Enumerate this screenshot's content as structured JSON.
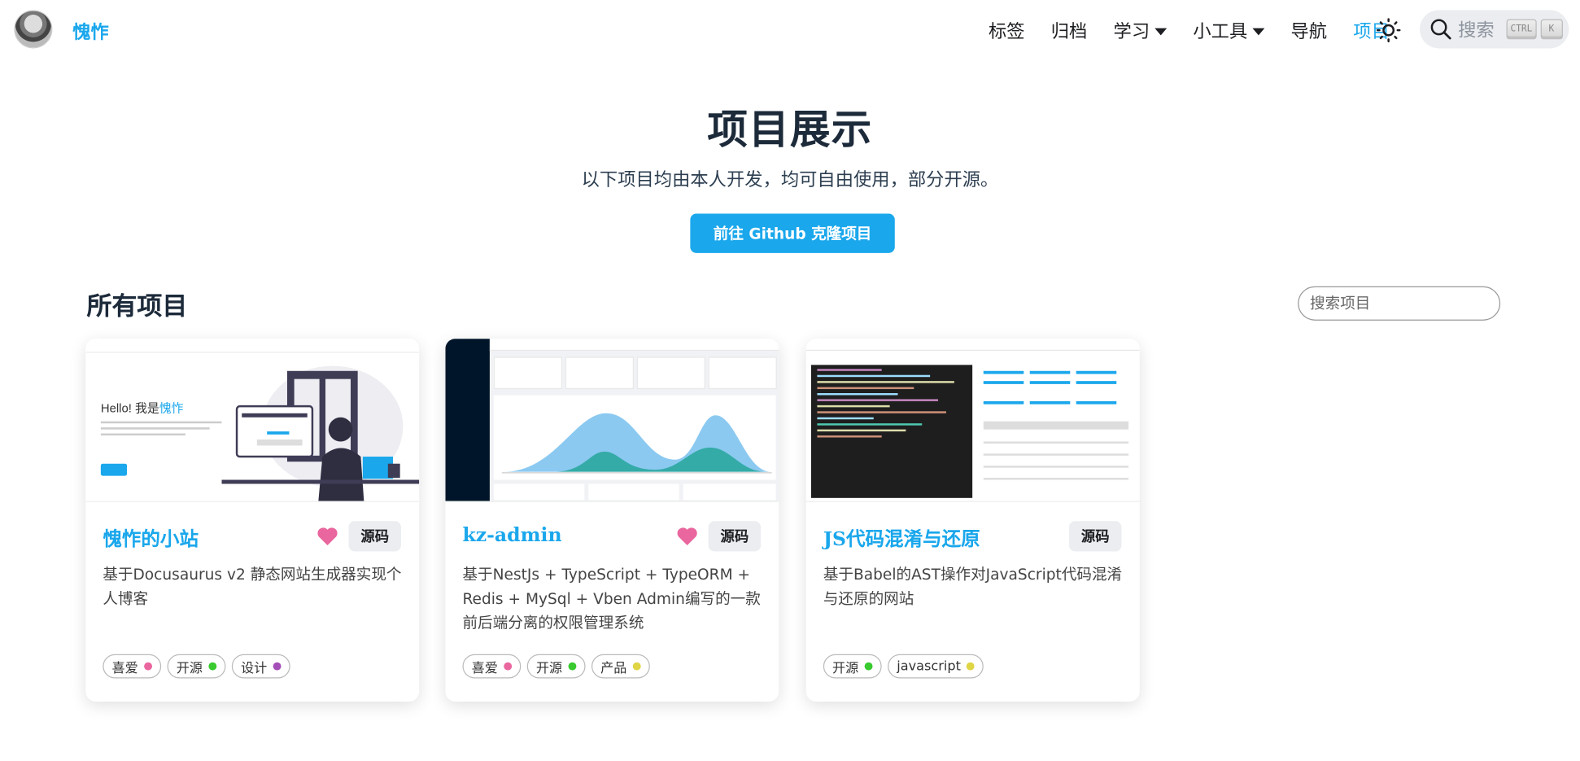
{
  "navbar": {
    "brand": "愧怍",
    "items": [
      {
        "label": "标签",
        "caret": false,
        "active": false
      },
      {
        "label": "归档",
        "caret": false,
        "active": false
      },
      {
        "label": "学习",
        "caret": true,
        "active": false
      },
      {
        "label": "小工具",
        "caret": true,
        "active": false
      },
      {
        "label": "导航",
        "caret": false,
        "active": false
      },
      {
        "label": "项目",
        "caret": false,
        "active": true
      }
    ],
    "search_placeholder": "搜索",
    "kbd_ctrl": "CTRL",
    "kbd_k": "K"
  },
  "hero": {
    "title": "项目展示",
    "subtitle": "以下项目均由本人开发，均可自由使用，部分开源。",
    "button": "前往 Github 克隆项目"
  },
  "projects_section": {
    "title": "所有项目",
    "search_placeholder": "搜索项目"
  },
  "cards": [
    {
      "title": "愧怍的小站",
      "favorite": true,
      "source_label": "源码",
      "description": "基于Docusaurus v2 静态网站生成器实现个人博客",
      "preview_text_prefix": "Hello! 我是",
      "preview_text_name": "愧怍",
      "tags": [
        {
          "label": "喜爱",
          "color": "#e9669e"
        },
        {
          "label": "开源",
          "color": "#39ca30"
        },
        {
          "label": "设计",
          "color": "#a44fb7"
        }
      ]
    },
    {
      "title": "kz-admin",
      "favorite": true,
      "source_label": "源码",
      "description": "基于NestJs + TypeScript + TypeORM + Redis + MySql + Vben Admin编写的一款前后端分离的权限管理系统",
      "tags": [
        {
          "label": "喜爱",
          "color": "#e9669e"
        },
        {
          "label": "开源",
          "color": "#39ca30"
        },
        {
          "label": "产品",
          "color": "#dfd545"
        }
      ]
    },
    {
      "title": "JS代码混淆与还原",
      "favorite": false,
      "source_label": "源码",
      "description": "基于Babel的AST操作对JavaScript代码混淆与还原的网站",
      "tags": [
        {
          "label": "开源",
          "color": "#39ca30"
        },
        {
          "label": "javascript",
          "color": "#dfd545"
        }
      ]
    }
  ],
  "colors": {
    "accent": "#1aa7ec",
    "heart": "#e9669e"
  }
}
